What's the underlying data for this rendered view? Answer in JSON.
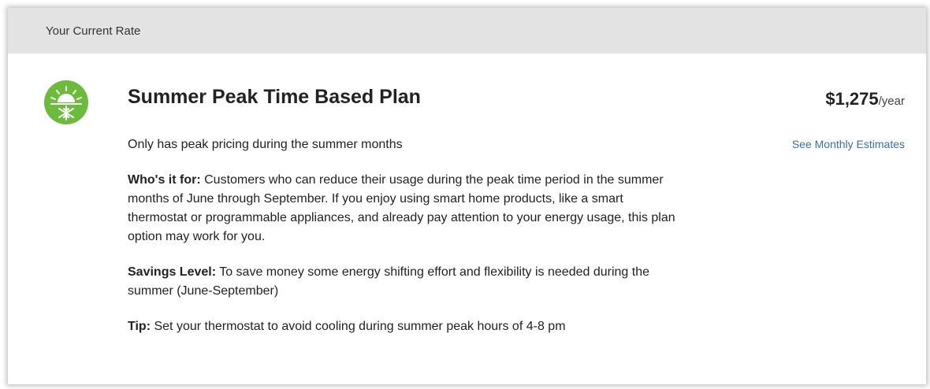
{
  "header": {
    "title": "Your Current Rate"
  },
  "plan": {
    "icon": "sun-snowflake-icon",
    "title": "Summer Peak Time Based Plan",
    "price_amount": "$1,275",
    "price_unit": "/year",
    "monthly_link": "See Monthly Estimates",
    "subtitle": "Only has peak pricing during the summer months",
    "who_label": "Who's it for:",
    "who_text": " Customers who can reduce their usage during the peak time period in the summer months of June through September. If you enjoy using smart home products, like a smart thermostat or programmable appliances, and already pay attention to your energy usage, this plan option may work for you.",
    "savings_label": "Savings Level:",
    "savings_text": " To save money some energy shifting effort and flexibility is needed during the summer (June-September)",
    "tip_label": "Tip:",
    "tip_text": " Set your thermostat to avoid cooling during summer peak hours of 4-8 pm"
  },
  "colors": {
    "icon_bg": "#6cbb3c",
    "link": "#3a6fa8",
    "header_bg": "#e3e3e3"
  }
}
